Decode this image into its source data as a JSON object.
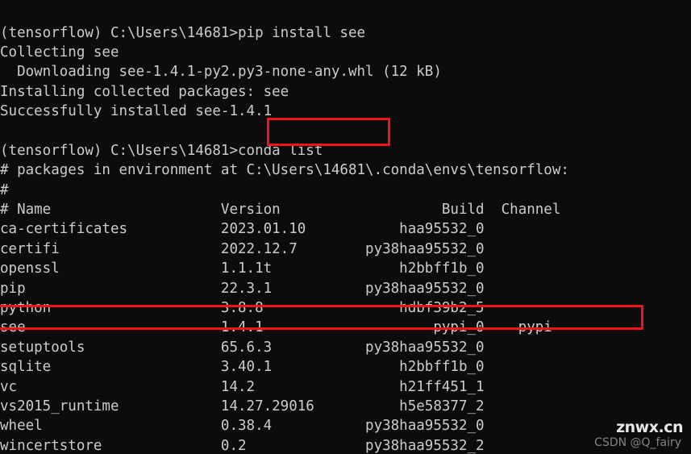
{
  "terminal": {
    "background_color": "#0c0c0c",
    "text_color": "#cccccc",
    "highlight_color": "#f01414",
    "prompt_env": "(tensorflow)",
    "prompt_path": "C:\\Users\\14681",
    "lines": [
      "(tensorflow) C:\\Users\\14681>pip install see",
      "Collecting see",
      "  Downloading see-1.4.1-py2.py3-none-any.whl (12 kB)",
      "Installing collected packages: see",
      "Successfully installed see-1.4.1",
      "",
      "(tensorflow) C:\\Users\\14681>conda list",
      "# packages in environment at C:\\Users\\14681\\.conda\\envs\\tensorflow:",
      "#",
      "# Name                    Version                   Build  Channel",
      "ca-certificates           2023.01.10           haa95532_0",
      "certifi                   2022.12.7        py38haa95532_0",
      "openssl                   1.1.1t               h2bbff1b_0",
      "pip                       22.3.1           py38haa95532_0",
      "python                    3.8.8                hdbf39b2_5",
      "see                       1.4.1                    pypi_0    pypi",
      "setuptools                65.6.3           py38haa95532_0",
      "sqlite                    3.40.1               h2bbff1b_0",
      "vc                        14.2                 h21ff451_1",
      "vs2015_runtime            14.27.29016          h5e58377_2",
      "wheel                     0.38.4           py38haa95532_0",
      "wincertstore              0.2              py38haa95532_2"
    ],
    "commands": {
      "pip_install": "pip install see",
      "conda_list": "conda list"
    },
    "pip_output": {
      "collecting": "Collecting see",
      "downloading": "Downloading see-1.4.1-py2.py3-none-any.whl (12 kB)",
      "wheel_file": "see-1.4.1-py2.py3-none-any.whl",
      "wheel_size": "12 kB",
      "installing": "Installing collected packages: see",
      "success": "Successfully installed see-1.4.1"
    },
    "conda_output": {
      "env_comment": "# packages in environment at C:\\Users\\14681\\.conda\\envs\\tensorflow:",
      "env_path": "C:\\Users\\14681\\.conda\\envs\\tensorflow",
      "blank_comment": "#",
      "columns": [
        "# Name",
        "Version",
        "Build",
        "Channel"
      ],
      "packages": [
        {
          "name": "ca-certificates",
          "version": "2023.01.10",
          "build": "haa95532_0",
          "channel": ""
        },
        {
          "name": "certifi",
          "version": "2022.12.7",
          "build": "py38haa95532_0",
          "channel": ""
        },
        {
          "name": "openssl",
          "version": "1.1.1t",
          "build": "h2bbff1b_0",
          "channel": ""
        },
        {
          "name": "pip",
          "version": "22.3.1",
          "build": "py38haa95532_0",
          "channel": ""
        },
        {
          "name": "python",
          "version": "3.8.8",
          "build": "hdbf39b2_5",
          "channel": ""
        },
        {
          "name": "see",
          "version": "1.4.1",
          "build": "pypi_0",
          "channel": "pypi"
        },
        {
          "name": "setuptools",
          "version": "65.6.3",
          "build": "py38haa95532_0",
          "channel": ""
        },
        {
          "name": "sqlite",
          "version": "3.40.1",
          "build": "h2bbff1b_0",
          "channel": ""
        },
        {
          "name": "vc",
          "version": "14.2",
          "build": "h21ff451_1",
          "channel": ""
        },
        {
          "name": "vs2015_runtime",
          "version": "14.27.29016",
          "build": "h5e58377_2",
          "channel": ""
        },
        {
          "name": "wheel",
          "version": "0.38.4",
          "build": "py38haa95532_0",
          "channel": ""
        },
        {
          "name": "wincertstore",
          "version": "0.2",
          "build": "py38haa95532_2",
          "channel": ""
        }
      ]
    },
    "annotations": [
      {
        "label": "conda list command highlight",
        "target": ">conda list"
      },
      {
        "label": "see package row highlight",
        "target": "see 1.4.1 pypi_0 pypi"
      }
    ]
  },
  "watermarks": {
    "site": "znwx.cn",
    "author": "CSDN @Q_fairy"
  }
}
